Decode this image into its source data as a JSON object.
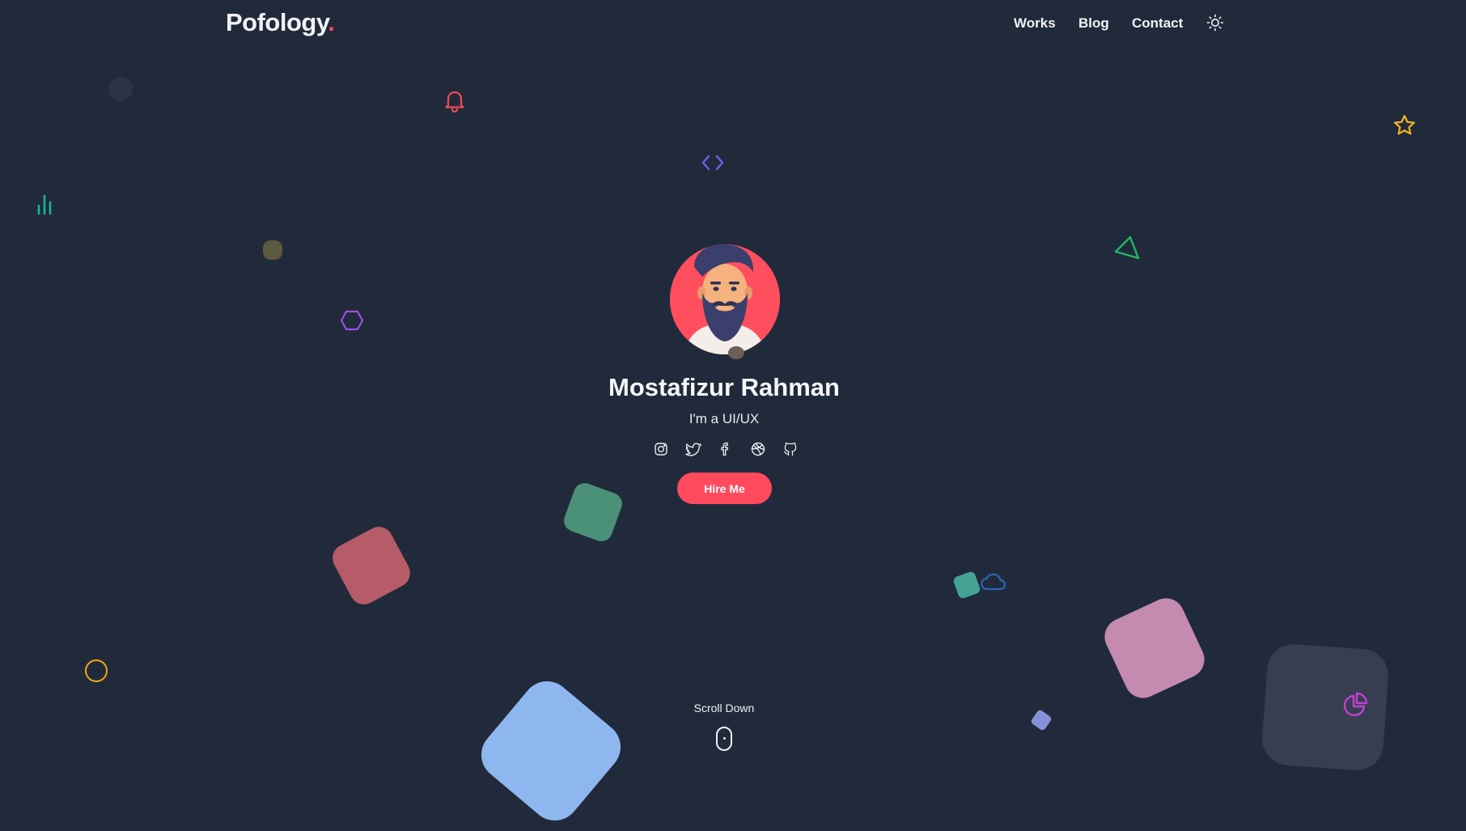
{
  "brand": {
    "name": "Pofology",
    "dot": ".",
    "accent": "#ff4a5e"
  },
  "nav": {
    "items": [
      {
        "label": "Works"
      },
      {
        "label": "Blog"
      },
      {
        "label": "Contact"
      }
    ],
    "theme_icon": "sun-icon"
  },
  "hero": {
    "name": "Mostafizur Rahman",
    "role": "I'm a UI/UX",
    "socials": [
      "instagram-icon",
      "twitter-icon",
      "facebook-icon",
      "dribbble-icon",
      "github-icon"
    ],
    "cta": "Hire Me",
    "scroll_label": "Scroll Down"
  },
  "colors": {
    "background": "#212a3b",
    "accent": "#ff4a5e",
    "text": "#f1f2f4"
  }
}
